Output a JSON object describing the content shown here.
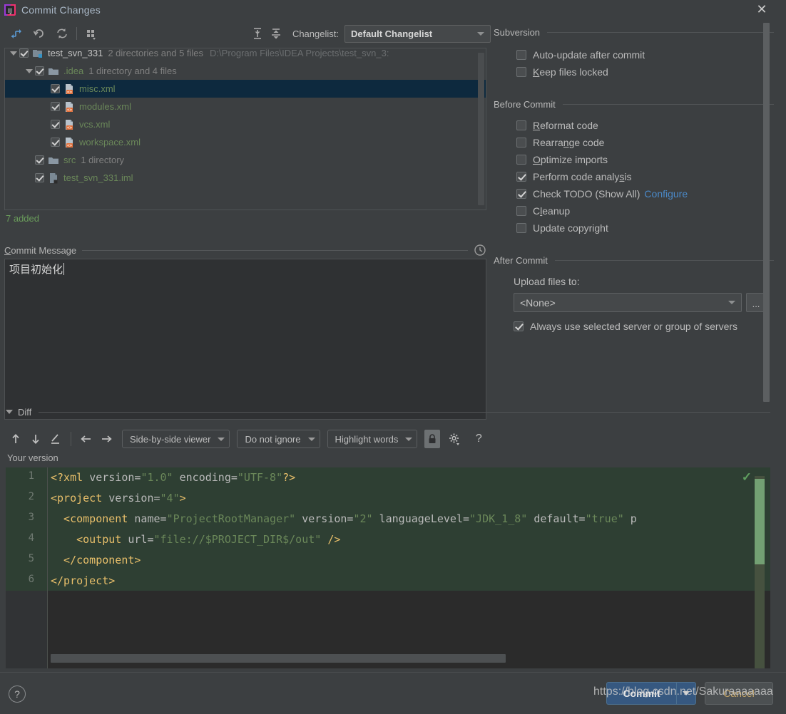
{
  "window": {
    "title": "Commit Changes",
    "app_icon": "intellij-idea-icon",
    "close_icon": "close-icon"
  },
  "toolbar": {
    "buttons": [
      {
        "name": "show-diff-icon",
        "glyph": "→‹"
      },
      {
        "name": "revert-icon",
        "glyph": "↺"
      },
      {
        "name": "refresh-icon",
        "glyph": "↻"
      },
      {
        "name": "group-by-icon",
        "glyph": "∷"
      },
      {
        "name": "expand-all-icon",
        "glyph": "⇳"
      },
      {
        "name": "collapse-all-icon",
        "glyph": "⇵"
      }
    ],
    "changelist_label": "Changelist",
    "changelist_label_suffix": ":",
    "changelist_value": "Default Changelist"
  },
  "tree": {
    "rows": [
      {
        "indent": 0,
        "twisty": "expanded",
        "checked": true,
        "icon": "module-icon",
        "name": "test_svn_331",
        "name_color": "white",
        "sub": "2 directories and 5 files",
        "path": "D:\\Program Files\\IDEA Projects\\test_svn_3:",
        "selected": false
      },
      {
        "indent": 1,
        "twisty": "expanded",
        "checked": true,
        "icon": "folder-icon",
        "name": ".idea",
        "name_color": "green",
        "sub": "1 directory and 4 files",
        "path": "",
        "selected": false
      },
      {
        "indent": 2,
        "twisty": "none",
        "checked": true,
        "icon": "xml-file-icon",
        "name": "misc.xml",
        "name_color": "green",
        "sub": "",
        "path": "",
        "selected": true
      },
      {
        "indent": 2,
        "twisty": "none",
        "checked": true,
        "icon": "xml-file-icon",
        "name": "modules.xml",
        "name_color": "green",
        "sub": "",
        "path": "",
        "selected": false
      },
      {
        "indent": 2,
        "twisty": "none",
        "checked": true,
        "icon": "xml-file-icon",
        "name": "vcs.xml",
        "name_color": "green",
        "sub": "",
        "path": "",
        "selected": false
      },
      {
        "indent": 2,
        "twisty": "none",
        "checked": true,
        "icon": "xml-file-icon",
        "name": "workspace.xml",
        "name_color": "green",
        "sub": "",
        "path": "",
        "selected": false
      },
      {
        "indent": 1,
        "twisty": "none",
        "checked": true,
        "icon": "folder-icon",
        "name": "src",
        "name_color": "green",
        "sub": "1 directory",
        "path": "",
        "selected": false
      },
      {
        "indent": 1,
        "twisty": "none",
        "checked": true,
        "icon": "iml-file-icon",
        "name": "test_svn_331.iml",
        "name_color": "green",
        "sub": "",
        "path": "",
        "selected": false
      }
    ],
    "added_count": "7 added"
  },
  "commit_message": {
    "section_label_first": "C",
    "section_label_rest": "ommit Message",
    "history_icon": "clock-icon",
    "value": "项目初始化",
    "placeholder": ""
  },
  "subversion": {
    "title": "Subversion",
    "options": [
      {
        "label": "Auto-update after commit",
        "checked": false,
        "mnemonic": "",
        "name": "auto-update-after-commit"
      },
      {
        "label": "Keep files locked",
        "checked": false,
        "mnemonic": "K",
        "name": "keep-files-locked"
      }
    ]
  },
  "before_commit": {
    "title": "Before Commit",
    "options": [
      {
        "label": "Reformat code",
        "checked": false,
        "mnemonic": "R",
        "name": "reformat-code"
      },
      {
        "label": "Rearrange code",
        "checked": false,
        "mnemonic": "n",
        "name": "rearrange-code"
      },
      {
        "label": "Optimize imports",
        "checked": false,
        "mnemonic": "O",
        "name": "optimize-imports"
      },
      {
        "label": "Perform code analysis",
        "checked": true,
        "mnemonic": "s",
        "name": "perform-code-analysis"
      },
      {
        "label": "Check TODO (Show All)",
        "checked": true,
        "mnemonic": "",
        "link": "Configure",
        "name": "check-todo"
      },
      {
        "label": "Cleanup",
        "checked": false,
        "mnemonic": "l",
        "name": "cleanup"
      },
      {
        "label": "Update copyright",
        "checked": false,
        "mnemonic": "",
        "name": "update-copyright"
      }
    ]
  },
  "after_commit": {
    "title": "After Commit",
    "upload_label": "Upload files to:",
    "upload_value": "<None>",
    "browse_label": "...",
    "always_use_label": "Always use selected server or group of servers",
    "always_use_checked": true
  },
  "diff": {
    "section_title": "Diff",
    "toolbar_icons": [
      {
        "name": "previous-difference-icon",
        "glyph": "↑"
      },
      {
        "name": "next-difference-icon",
        "glyph": "↓"
      },
      {
        "name": "edit-source-icon",
        "glyph": "╱"
      },
      {
        "name": "accept-left-icon",
        "glyph": "←"
      },
      {
        "name": "accept-right-icon",
        "glyph": "→"
      }
    ],
    "viewer_mode": "Side-by-side viewer",
    "ignore_mode": "Do not ignore",
    "highlight_mode": "Highlight words",
    "lock_icon": "lock-icon",
    "settings_icon": "gear-icon",
    "help_icon": "question-icon",
    "your_version_label": "Your version",
    "status_ok_icon": "checkmark-icon",
    "line_numbers": [
      "1",
      "2",
      "3",
      "4",
      "5",
      "6"
    ],
    "code_lines": [
      [
        {
          "t": "<?xml ",
          "c": "tag"
        },
        {
          "t": "version=",
          "c": "attr"
        },
        {
          "t": "\"1.0\"",
          "c": "str"
        },
        {
          "t": " encoding=",
          "c": "attr"
        },
        {
          "t": "\"UTF-8\"",
          "c": "str"
        },
        {
          "t": "?>",
          "c": "tag"
        }
      ],
      [
        {
          "t": "<project ",
          "c": "tag"
        },
        {
          "t": "version=",
          "c": "attr"
        },
        {
          "t": "\"4\"",
          "c": "str"
        },
        {
          "t": ">",
          "c": "tag"
        }
      ],
      [
        {
          "t": "  <component ",
          "c": "tag"
        },
        {
          "t": "name=",
          "c": "attr"
        },
        {
          "t": "\"ProjectRootManager\"",
          "c": "str"
        },
        {
          "t": " version=",
          "c": "attr"
        },
        {
          "t": "\"2\"",
          "c": "str"
        },
        {
          "t": " languageLevel=",
          "c": "attr"
        },
        {
          "t": "\"JDK_1_8\"",
          "c": "str"
        },
        {
          "t": " default=",
          "c": "attr"
        },
        {
          "t": "\"true\"",
          "c": "str"
        },
        {
          "t": " p",
          "c": "attr"
        }
      ],
      [
        {
          "t": "    <output ",
          "c": "tag"
        },
        {
          "t": "url=",
          "c": "attr"
        },
        {
          "t": "\"file://$PROJECT_DIR$/out\"",
          "c": "str"
        },
        {
          "t": " />",
          "c": "tag"
        }
      ],
      [
        {
          "t": "  </component>",
          "c": "tag"
        }
      ],
      [
        {
          "t": "</project>",
          "c": "tag"
        }
      ]
    ]
  },
  "footer": {
    "help_label": "?",
    "commit_label": "Commit",
    "commit_dropdown_icon": "chevron-down-icon",
    "cancel_label": "Cancel",
    "watermark": "https://blog.csdn.net/Sakuraaaaaaa"
  },
  "colors": {
    "accent_blue": "#365880",
    "selection": "#0d293e",
    "added_green": "#6a9d5b",
    "diff_green_bg": "#2e3f33",
    "link_blue": "#4a89c8"
  }
}
